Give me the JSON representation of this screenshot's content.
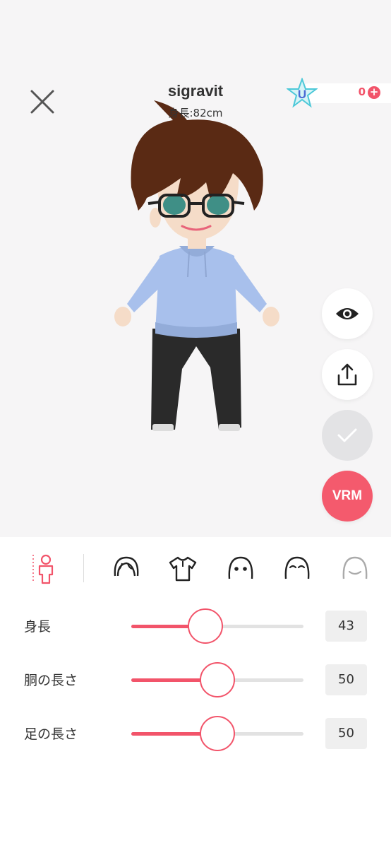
{
  "header": {
    "avatar_name": "sigravit",
    "avatar_height": "身長:82cm"
  },
  "currency": {
    "icon": "u-star-coin-icon",
    "count": "0",
    "add_symbol": "+"
  },
  "side_actions": {
    "preview_icon": "eye-icon",
    "share_icon": "share-upload-icon",
    "confirm_icon": "checkmark-icon",
    "vrm_label": "VRM"
  },
  "tabs": [
    {
      "icon": "body-shape-icon",
      "active": true
    },
    {
      "icon": "hair-icon",
      "active": false
    },
    {
      "icon": "clothing-icon",
      "active": false
    },
    {
      "icon": "face-eyes-icon",
      "active": false
    },
    {
      "icon": "face-brows-icon",
      "active": false
    },
    {
      "icon": "face-mouth-icon",
      "active": false
    }
  ],
  "sliders": [
    {
      "label": "身長",
      "value": "43",
      "fraction": 0.43
    },
    {
      "label": "胴の長さ",
      "value": "50",
      "fraction": 0.5
    },
    {
      "label": "足の長さ",
      "value": "50",
      "fraction": 0.5
    }
  ],
  "colors": {
    "accent": "#f2546a",
    "stage_bg": "#f6f5f6",
    "confirm_disabled": "#e3e3e5",
    "hoodie": "#a8c0ec",
    "pants": "#2a2a2a",
    "hair": "#5a2a14"
  }
}
